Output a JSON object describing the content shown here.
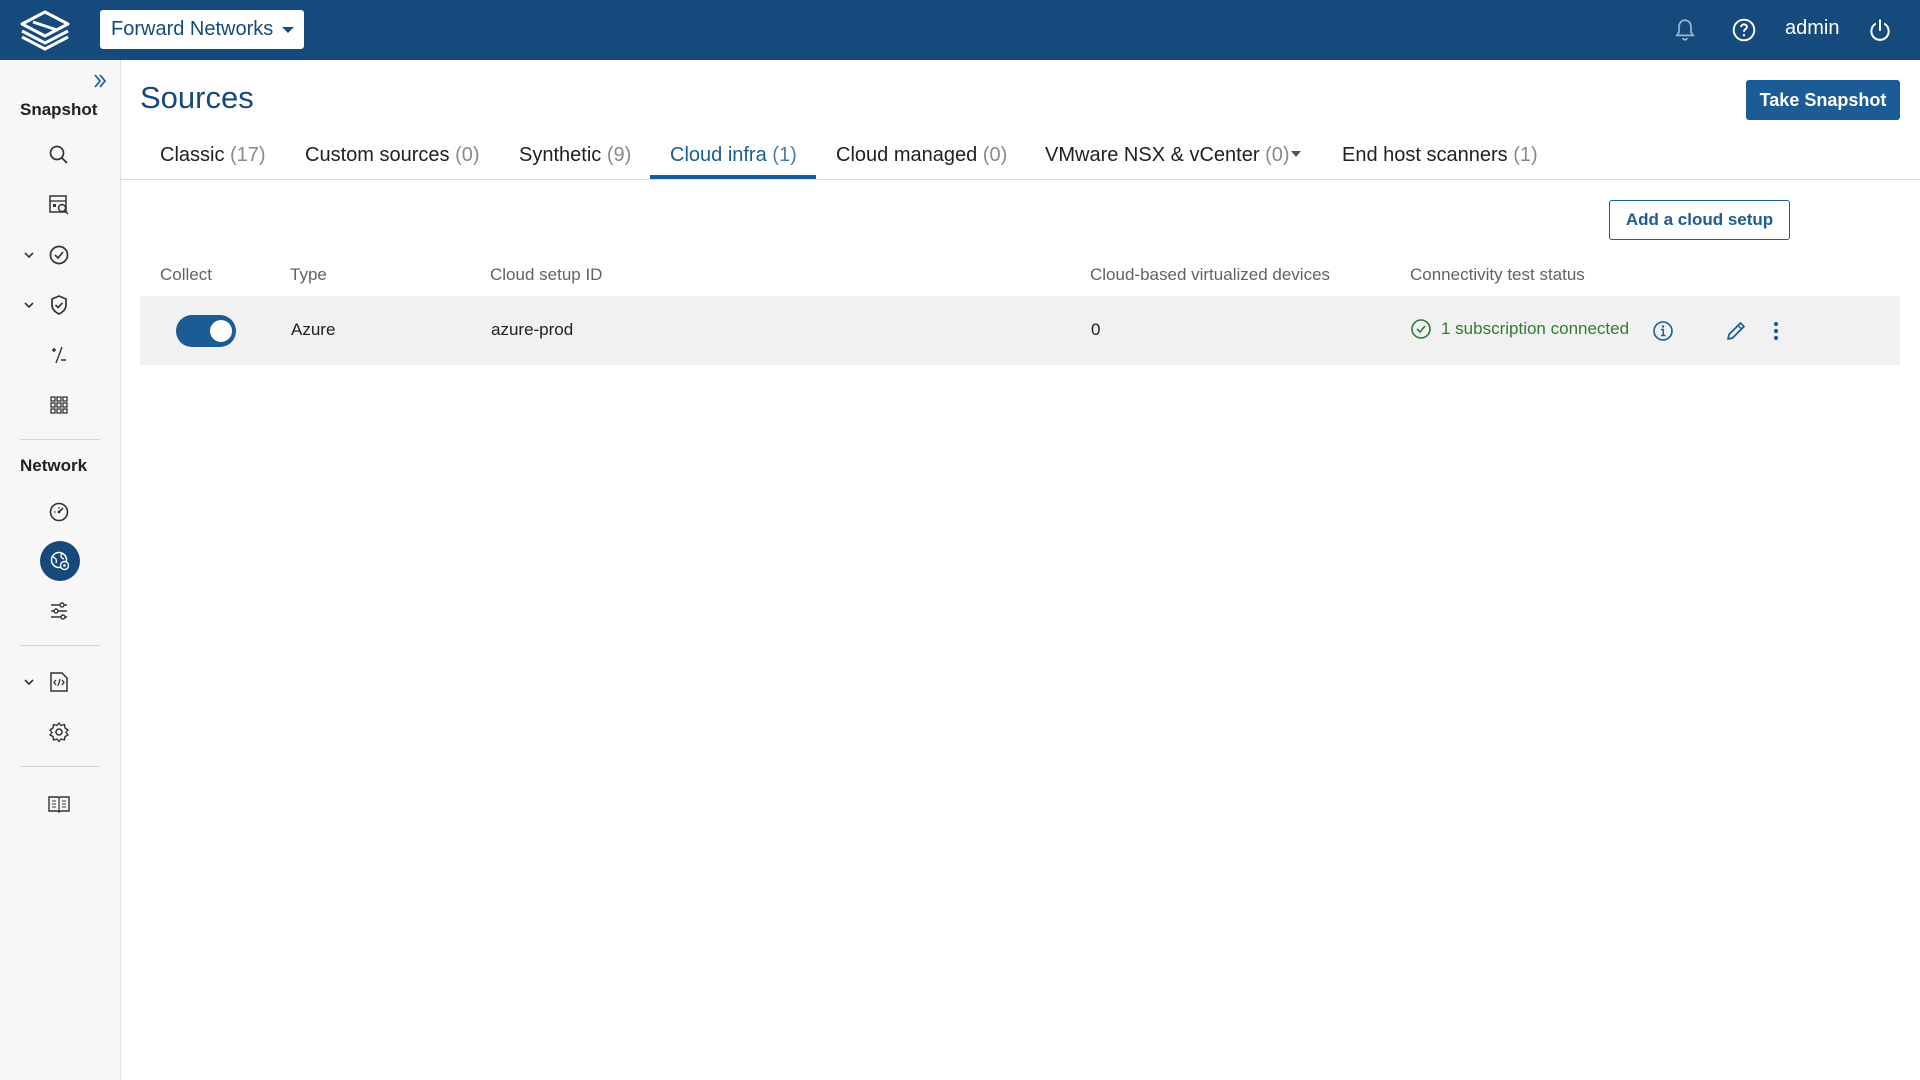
{
  "topbar": {
    "org_name": "Forward Networks",
    "user": "admin",
    "icons": [
      "logo-icon",
      "bell-icon",
      "help-icon",
      "power-icon"
    ]
  },
  "sidebar": {
    "snapshot_heading": "Snapshot",
    "network_heading": "Network",
    "items": [
      "search-icon",
      "snapshot-devices-icon",
      "verify-check-icon",
      "shield-icon",
      "plus-minus-icon",
      "apps-grid-icon",
      "dashboard-gauge-icon",
      "sources-globe-icon",
      "filters-sliders-icon",
      "code-file-icon",
      "settings-gear-icon",
      "docs-book-icon"
    ]
  },
  "page": {
    "title": "Sources",
    "take_snapshot": "Take Snapshot",
    "add_cloud_setup": "Add a cloud setup"
  },
  "tabs": [
    {
      "label": "Classic",
      "count": "(17)"
    },
    {
      "label": "Custom sources",
      "count": "(0)"
    },
    {
      "label": "Synthetic",
      "count": "(9)"
    },
    {
      "label": "Cloud infra",
      "count": "(1)"
    },
    {
      "label": "Cloud managed",
      "count": "(0)"
    },
    {
      "label": "VMware NSX & vCenter",
      "count": "(0)"
    },
    {
      "label": "End host scanners",
      "count": "(1)"
    }
  ],
  "active_tab": "Cloud infra",
  "table": {
    "headers": [
      "Collect",
      "Type",
      "Cloud setup ID",
      "Cloud-based virtualized devices",
      "Connectivity test status"
    ],
    "rows": [
      {
        "collect": true,
        "type": "Azure",
        "setup_id": "azure-prod",
        "devices": "0",
        "status": "1 subscription connected"
      }
    ]
  },
  "colors": {
    "brand": "#174a7c",
    "accent": "#1b5c96",
    "success": "#2e7d32"
  }
}
